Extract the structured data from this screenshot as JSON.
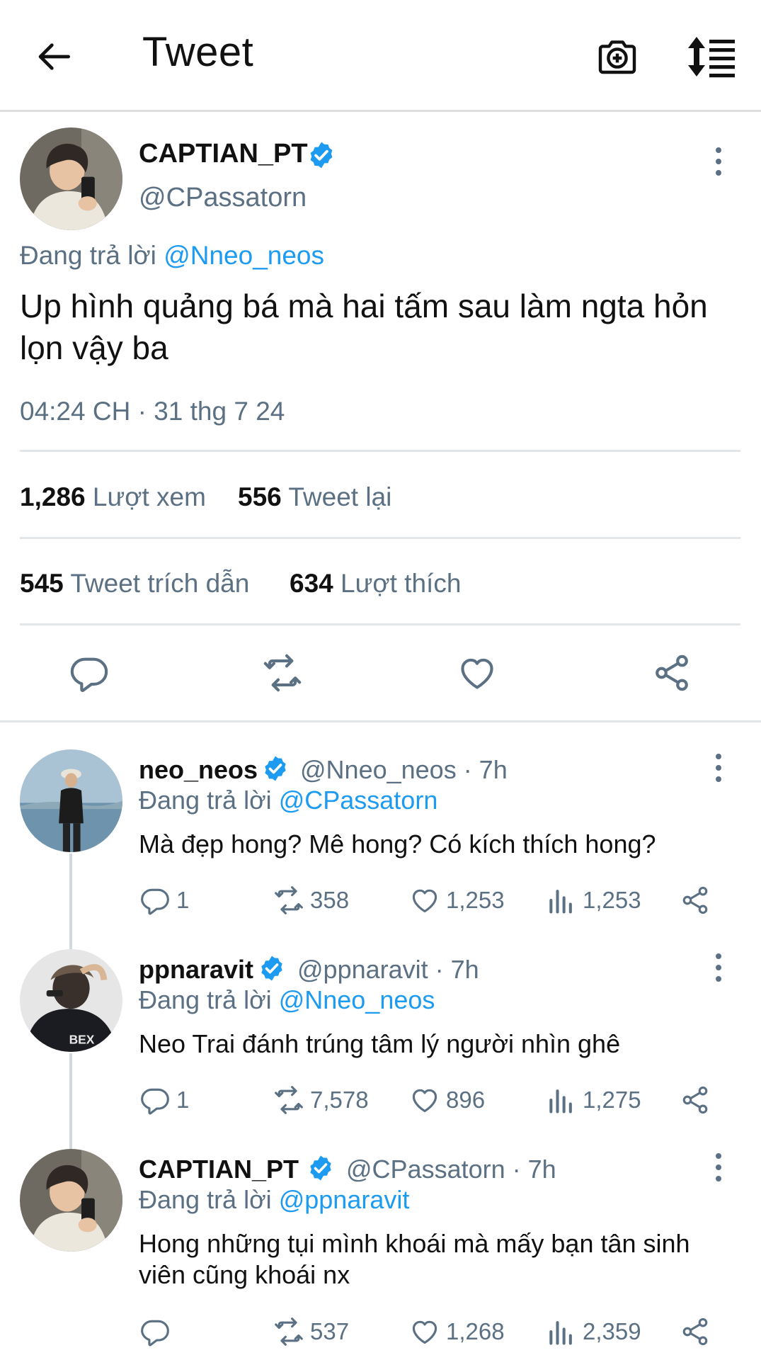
{
  "header": {
    "title": "Tweet"
  },
  "tweet": {
    "name": "CAPTIAN_PT",
    "handle": "@CPassatorn",
    "reply_prefix": "Đang trả lời",
    "reply_to": "@Nneo_neos",
    "text": "Up hình quảng bá mà hai tấm sau làm ngta hỏn lọn vậy ba",
    "timestamp": "04:24 CH · 31 thg 7 24",
    "stats": {
      "views_count": "1,286",
      "views_label": "Lượt xem",
      "retweets_count": "556",
      "retweets_label": "Tweet lại",
      "quotes_count": "545",
      "quotes_label": "Tweet trích dẫn",
      "likes_count": "634",
      "likes_label": "Lượt thích"
    }
  },
  "replies": [
    {
      "name": "neo_neos",
      "meta": "@Nneo_neos · 7h",
      "reply_prefix": "Đang trả lời",
      "reply_to": "@CPassatorn",
      "text": "Mà đẹp hong? Mê hong? Có kích thích hong?",
      "replies": "1",
      "retweets": "358",
      "likes": "1,253",
      "views": "1,253"
    },
    {
      "name": "ppnaravit",
      "meta": "@ppnaravit · 7h",
      "reply_prefix": "Đang trả lời",
      "reply_to": "@Nneo_neos",
      "text": "Neo Trai đánh trúng tâm lý người nhìn ghê",
      "replies": "1",
      "retweets": "7,578",
      "likes": "896",
      "views": "1,275"
    },
    {
      "name": "CAPTIAN_PT",
      "meta": "@CPassatorn · 7h",
      "reply_prefix": "Đang trả lời",
      "reply_to": "@ppnaravit",
      "text": "Hong những tụi mình khoái mà mấy bạn tân sinh viên cũng khoái nx",
      "replies": "",
      "retweets": "537",
      "likes": "1,268",
      "views": "2,359"
    }
  ],
  "colors": {
    "accent": "#1d9bf0",
    "secondary_text": "#5b7083",
    "divider": "#e2e6e9"
  }
}
